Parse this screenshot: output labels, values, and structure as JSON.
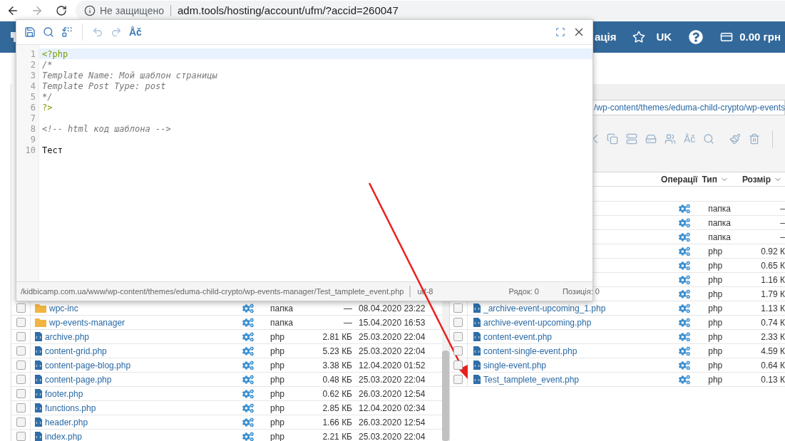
{
  "browser": {
    "security_label": "Не защищено",
    "url": "adm.tools/hosting/account/ufm/?accid=260047"
  },
  "header": {
    "nav_fragment": "ація",
    "language": "UK",
    "balance": "0.00 грн"
  },
  "left_panel": {
    "rows": [
      {
        "kind": "folder",
        "name": "wpc-inc",
        "type": "папка",
        "size": "—",
        "date": "08.04.2020 23:22",
        "checked": false
      },
      {
        "kind": "folder",
        "name": "wp-events-manager",
        "type": "папка",
        "size": "—",
        "date": "15.04.2020 16:53",
        "checked": false
      },
      {
        "kind": "file",
        "name": "archive.php",
        "type": "php",
        "size": "2.81 КБ",
        "date": "25.03.2020 22:04",
        "checked": false
      },
      {
        "kind": "file",
        "name": "content-grid.php",
        "type": "php",
        "size": "5.23 КБ",
        "date": "25.03.2020 22:04",
        "checked": false
      },
      {
        "kind": "file",
        "name": "content-page-blog.php",
        "type": "php",
        "size": "3.38 КБ",
        "date": "12.04.2020 01:52",
        "checked": false
      },
      {
        "kind": "file",
        "name": "content-page.php",
        "type": "php",
        "size": "0.48 КБ",
        "date": "25.03.2020 22:04",
        "checked": false
      },
      {
        "kind": "file",
        "name": "footer.php",
        "type": "php",
        "size": "0.62 КБ",
        "date": "26.03.2020 12:54",
        "checked": false
      },
      {
        "kind": "file",
        "name": "functions.php",
        "type": "php",
        "size": "2.85 КБ",
        "date": "12.04.2020 02:34",
        "checked": false
      },
      {
        "kind": "file",
        "name": "header.php",
        "type": "php",
        "size": "1.66 КБ",
        "date": "26.03.2020 12:54",
        "checked": false
      },
      {
        "kind": "file",
        "name": "index.php",
        "type": "php",
        "size": "2.21 КБ",
        "date": "25.03.2020 22:04",
        "checked": false
      }
    ]
  },
  "right_panel": {
    "path": "/wp-content/themes/eduma-child-crypto/wp-events",
    "toolbar_text": "Åč",
    "columns": [
      {
        "label": "Операції",
        "sortable": false
      },
      {
        "label": "Тип",
        "sortable": true
      },
      {
        "label": "Розмір",
        "sortable": true
      }
    ],
    "rows": [
      {
        "type": "папка",
        "size": "–"
      },
      {
        "type": "папка",
        "size": "–"
      },
      {
        "type": "папка",
        "size": "–"
      },
      {
        "type": "php",
        "size": "0.92 К"
      },
      {
        "type": "php",
        "size": "0.65 К"
      },
      {
        "type": "php",
        "size": "1.16 К"
      },
      {
        "type": "php",
        "size": "1.79 К"
      },
      {
        "kind": "file",
        "name": "_archive-event-upcoming_1.php",
        "type": "php",
        "size": "1.13 К",
        "checked": false
      },
      {
        "kind": "file",
        "name": "archive-event-upcoming.php",
        "type": "php",
        "size": "0.74 К",
        "checked": false
      },
      {
        "kind": "file",
        "name": "content-event.php",
        "type": "php",
        "size": "2.33 К",
        "checked": false
      },
      {
        "kind": "file",
        "name": "content-single-event.php",
        "type": "php",
        "size": "4.59 К",
        "checked": false
      },
      {
        "kind": "file",
        "name": "single-event.php",
        "type": "php",
        "size": "0.64 К",
        "checked": false
      },
      {
        "kind": "file",
        "name": "Test_tamplete_event.php",
        "type": "php",
        "size": "0.13 К",
        "checked": false
      }
    ]
  },
  "editor": {
    "toolbar_text": "Åč",
    "lines": [
      {
        "number": "1",
        "kind": "tag",
        "text": "<?php",
        "active": true
      },
      {
        "number": "2",
        "kind": "comment",
        "text": "/*",
        "active": false
      },
      {
        "number": "3",
        "kind": "comment",
        "text": "Template Name: Мой шаблон страницы",
        "active": false
      },
      {
        "number": "4",
        "kind": "comment",
        "text": "Template Post Type: post",
        "active": false
      },
      {
        "number": "5",
        "kind": "comment",
        "text": "*/",
        "active": false
      },
      {
        "number": "6",
        "kind": "tag",
        "text": "?>",
        "active": false
      },
      {
        "number": "7",
        "active": false
      },
      {
        "number": "8",
        "kind": "comment",
        "text": "<!-- html код шаблона -->",
        "active": false
      },
      {
        "number": "9",
        "active": false
      },
      {
        "number": "10",
        "kind": "plain",
        "text": "Тест",
        "active": false
      }
    ],
    "file_path": "/kidbicamp.com.ua/www/wp-content/themes/eduma-child-crypto/wp-events-manager/Test_tamplete_event.php",
    "encoding": "utf-8",
    "line_label": "Рядок: 0",
    "position_label": "Позиція: 0"
  }
}
